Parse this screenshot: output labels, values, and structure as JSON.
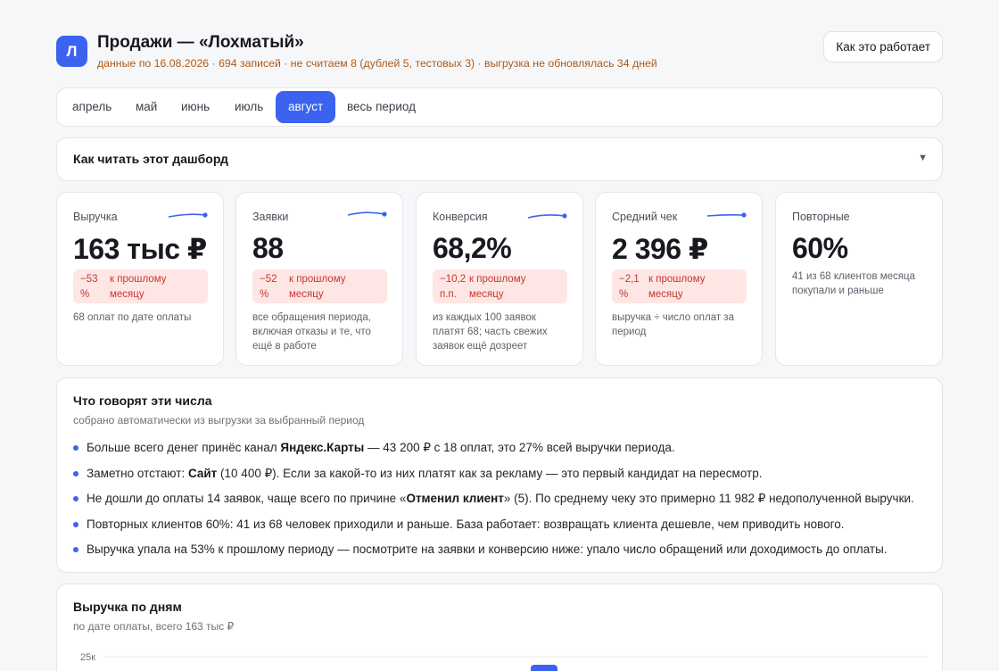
{
  "header": {
    "logo_letter": "Л",
    "title": "Продажи — «Лохматый»",
    "subtitle": "данные по 16.08.2026 · 694 записей · не считаем 8 (дублей 5, тестовых 3) · выгрузка не обновлялась 34 дней",
    "help_button": "Как это работает"
  },
  "tabs": [
    {
      "label": "апрель",
      "active": false
    },
    {
      "label": "май",
      "active": false
    },
    {
      "label": "июнь",
      "active": false
    },
    {
      "label": "июль",
      "active": false
    },
    {
      "label": "август",
      "active": true
    },
    {
      "label": "весь период",
      "active": false
    }
  ],
  "accordion": {
    "title": "Как читать этот дашборд",
    "caret": "▼"
  },
  "kpis": [
    {
      "label": "Выручка",
      "value": "163 тыс ₽",
      "delta_value": "−53 %",
      "delta_text": "к прошлому месяцу",
      "note": "68 оплат по дате оплаты"
    },
    {
      "label": "Заявки",
      "value": "88",
      "delta_value": "−52 %",
      "delta_text": "к прошлому месяцу",
      "note": "все обращения периода, включая отказы и те, что ещё в работе"
    },
    {
      "label": "Конверсия",
      "value": "68,2%",
      "delta_value": "−10,2 п.п.",
      "delta_text": "к прошлому месяцу",
      "note": "из каждых 100 заявок платят 68; часть свежих заявок ещё дозреет"
    },
    {
      "label": "Средний чек",
      "value": "2 396 ₽",
      "delta_value": "−2,1 %",
      "delta_text": "к прошлому месяцу",
      "note": "выручка ÷ число оплат за период"
    },
    {
      "label": "Повторные",
      "value": "60%",
      "note": "41 из 68 клиентов месяца покупали и раньше"
    }
  ],
  "colors": {
    "accent": "#3b63f0",
    "warning_text": "#b05a16",
    "negative_bg": "#fde6e4",
    "negative_text": "#c8372d"
  },
  "insights": {
    "title": "Что говорят эти числа",
    "subtitle": "собрано автоматически из выгрузки за выбранный период",
    "items": [
      {
        "pre": "Больше всего денег принёс канал ",
        "bold": "Яндекс.Карты",
        "post": " — 43 200 ₽ с 18 оплат, это 27% всей выручки периода."
      },
      {
        "pre": "Заметно отстают: ",
        "bold": "Сайт",
        "post": " (10 400 ₽). Если за какой-то из них платят как за рекламу — это первый кандидат на пересмотр."
      },
      {
        "pre": "Не дошли до оплаты 14 заявок, чаще всего по причине «",
        "bold": "Отменил клиент",
        "post": "» (5). По среднему чеку это примерно 11 982 ₽ недополученной выручки."
      },
      {
        "pre": "Повторных клиентов 60%: 41 из 68 человек приходили и раньше. База работает: возвращать клиента дешевле, чем приводить нового.",
        "bold": "",
        "post": ""
      },
      {
        "pre": "Выручка упала на 53% к прошлому периоду — посмотрите на заявки и конверсию ниже: упало число обращений или доходимость до оплаты.",
        "bold": "",
        "post": ""
      }
    ]
  },
  "revenue": {
    "title": "Выручка по дням",
    "subtitle": "по дате оплаты, всего 163 тыс ₽",
    "y_tick_label": "25к"
  }
}
